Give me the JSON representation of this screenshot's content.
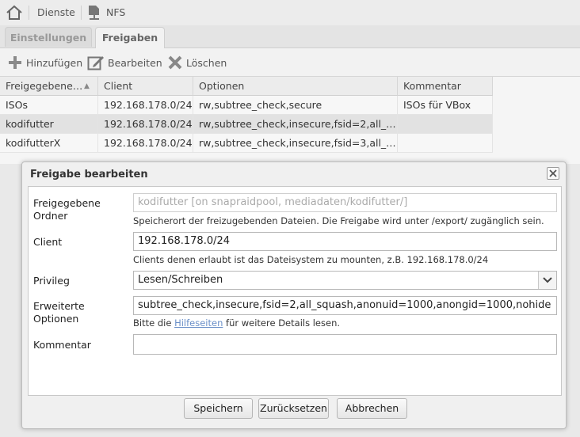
{
  "breadcrumb": {
    "services": "Dienste",
    "nfs": "NFS"
  },
  "tabs": {
    "settings": "Einstellungen",
    "shares": "Freigaben"
  },
  "toolbar": {
    "add": "Hinzufügen",
    "edit": "Bearbeiten",
    "delete": "Löschen"
  },
  "grid": {
    "columns": [
      "Freigegebene…",
      "Client",
      "Optionen",
      "Kommentar"
    ],
    "rows": [
      {
        "folder": "ISOs",
        "client": "192.168.178.0/24",
        "options": "rw,subtree_check,secure",
        "comment": "ISOs für VBox"
      },
      {
        "folder": "kodifutter",
        "client": "192.168.178.0/24",
        "options": "rw,subtree_check,insecure,fsid=2,all_squ…",
        "comment": ""
      },
      {
        "folder": "kodifutterX",
        "client": "192.168.178.0/24",
        "options": "rw,subtree_check,insecure,fsid=3,all_squ…",
        "comment": ""
      }
    ]
  },
  "dialog": {
    "title": "Freigabe bearbeiten",
    "folder_label_1": "Freigegebene",
    "folder_label_2": "Ordner",
    "folder_value": "kodifutter [on snapraidpool, mediadaten/kodifutter/]",
    "folder_hint": "Speicherort der freizugebenden Dateien. Die Freigabe wird unter /export/ zugänglich sein.",
    "client_label": "Client",
    "client_value": "192.168.178.0/24",
    "client_hint": "Clients denen erlaubt ist das Dateisystem zu mounten, z.B. 192.168.178.0/24",
    "privilege_label": "Privileg",
    "privilege_value": "Lesen/Schreiben",
    "ext_label_1": "Erweiterte",
    "ext_label_2": "Optionen",
    "ext_value": "subtree_check,insecure,fsid=2,all_squash,anonuid=1000,anongid=1000,nohide",
    "ext_hint_pre": "Bitte die",
    "ext_hint_link": "Hilfeseiten",
    "ext_hint_post": "für weitere Details lesen.",
    "comment_label": "Kommentar",
    "comment_value": "",
    "save": "Speichern",
    "reset": "Zurücksetzen",
    "cancel": "Abbrechen"
  },
  "colors": {
    "link": "#6a8fc8",
    "selected_row": "#e2e2e2",
    "add_icon": "#8a8a8a"
  }
}
